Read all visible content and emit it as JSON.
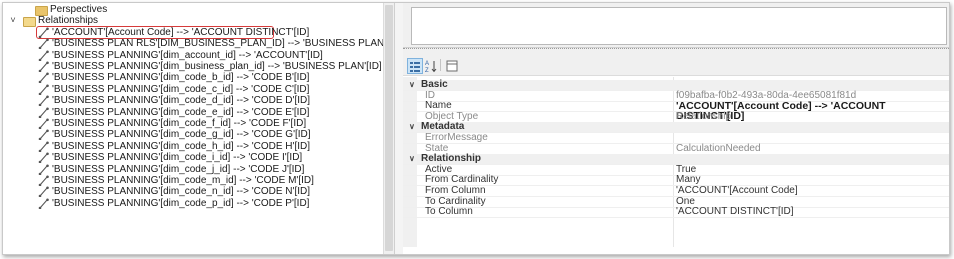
{
  "tree": {
    "items": [
      {
        "label": "Perspectives",
        "kind": "folder",
        "depth": 1
      },
      {
        "label": "Relationships",
        "kind": "folder-open",
        "depth": 0
      },
      {
        "label": "'ACCOUNT'[Account Code] --> 'ACCOUNT DISTINCT'[ID]",
        "kind": "relationship",
        "selected": true
      },
      {
        "label": "'BUSINESS PLAN RLS'[DIM_BUSINESS_PLAN_ID] --> 'BUSINESS PLAN'[ID]",
        "kind": "relationship"
      },
      {
        "label": "'BUSINESS PLANNING'[dim_account_id] --> 'ACCOUNT'[ID]",
        "kind": "relationship"
      },
      {
        "label": "'BUSINESS PLANNING'[dim_business_plan_id] --> 'BUSINESS PLAN'[ID]",
        "kind": "relationship"
      },
      {
        "label": "'BUSINESS PLANNING'[dim_code_b_id] --> 'CODE B'[ID]",
        "kind": "relationship"
      },
      {
        "label": "'BUSINESS PLANNING'[dim_code_c_id] --> 'CODE C'[ID]",
        "kind": "relationship"
      },
      {
        "label": "'BUSINESS PLANNING'[dim_code_d_id] --> 'CODE D'[ID]",
        "kind": "relationship"
      },
      {
        "label": "'BUSINESS PLANNING'[dim_code_e_id] --> 'CODE E'[ID]",
        "kind": "relationship"
      },
      {
        "label": "'BUSINESS PLANNING'[dim_code_f_id] --> 'CODE F'[ID]",
        "kind": "relationship"
      },
      {
        "label": "'BUSINESS PLANNING'[dim_code_g_id] --> 'CODE G'[ID]",
        "kind": "relationship"
      },
      {
        "label": "'BUSINESS PLANNING'[dim_code_h_id] --> 'CODE H'[ID]",
        "kind": "relationship"
      },
      {
        "label": "'BUSINESS PLANNING'[dim_code_i_id] --> 'CODE I'[ID]",
        "kind": "relationship"
      },
      {
        "label": "'BUSINESS PLANNING'[dim_code_j_id] --> 'CODE J'[ID]",
        "kind": "relationship"
      },
      {
        "label": "'BUSINESS PLANNING'[dim_code_m_id] --> 'CODE M'[ID]",
        "kind": "relationship"
      },
      {
        "label": "'BUSINESS PLANNING'[dim_code_n_id] --> 'CODE N'[ID]",
        "kind": "relationship"
      },
      {
        "label": "'BUSINESS PLANNING'[dim_code_p_id] --> 'CODE P'[ID]",
        "kind": "relationship"
      }
    ]
  },
  "toolbar": {
    "categorized_icon": "categorized-icon",
    "alphabetical_icon": "sort-alphabetical-icon",
    "pages_icon": "property-pages-icon"
  },
  "properties": {
    "categories": [
      {
        "name": "Basic",
        "rows": [
          {
            "key": "ID",
            "value": "f09bafba-f0b2-493a-80da-4ee65081f81d",
            "dim": true
          },
          {
            "key": "Name",
            "value": "'ACCOUNT'[Account Code] --> 'ACCOUNT DISTINCT'[ID]",
            "bold": true
          },
          {
            "key": "Object Type",
            "value": "Relationship",
            "dim": true
          }
        ]
      },
      {
        "name": "Metadata",
        "rows": [
          {
            "key": "ErrorMessage",
            "value": "",
            "dim": true
          },
          {
            "key": "State",
            "value": "CalculationNeeded",
            "dim": true
          }
        ]
      },
      {
        "name": "Relationship",
        "rows": [
          {
            "key": "Active",
            "value": "True"
          },
          {
            "key": "From Cardinality",
            "value": "Many"
          },
          {
            "key": "From Column",
            "value": "'ACCOUNT'[Account Code]"
          },
          {
            "key": "To Cardinality",
            "value": "One"
          },
          {
            "key": "To Column",
            "value": "'ACCOUNT DISTINCT'[ID]"
          }
        ]
      }
    ]
  },
  "colors": {
    "selection_outline": "#d63a3a",
    "folder": "#e9c46a",
    "panel_bg": "#f0f0f0"
  }
}
